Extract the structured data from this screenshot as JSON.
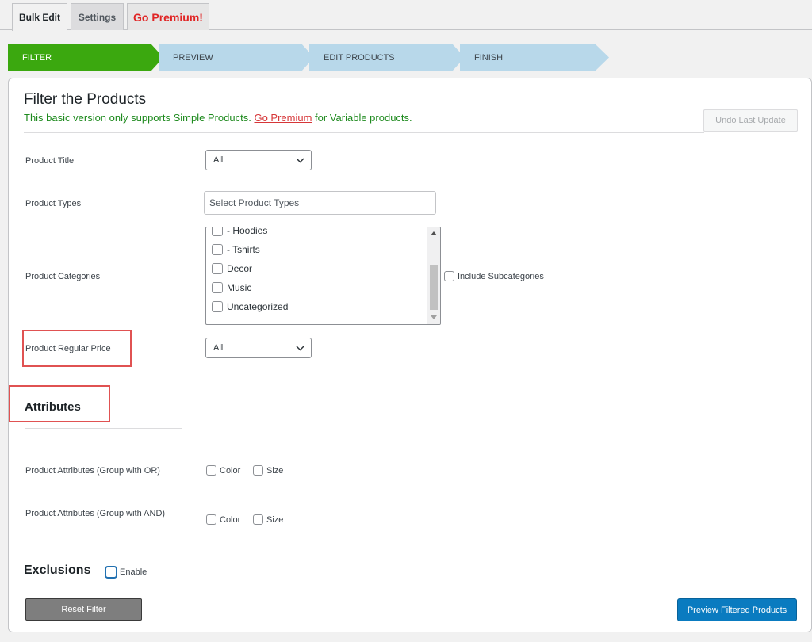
{
  "tabs": [
    {
      "label": "Bulk Edit"
    },
    {
      "label": "Settings"
    },
    {
      "label": "Go Premium!"
    }
  ],
  "steps": [
    {
      "label": "FILTER",
      "color": "#3ba80f",
      "text_color": "#ffffff"
    },
    {
      "label": "PREVIEW",
      "color": "#b8d8ea",
      "text_color": "#3c434a"
    },
    {
      "label": "EDIT PRODUCTS",
      "color": "#b8d8ea",
      "text_color": "#3c434a"
    },
    {
      "label": "FINISH",
      "color": "#b8d8ea",
      "text_color": "#3c434a"
    }
  ],
  "panel": {
    "title": "Filter the Products",
    "note_before": "This basic version only supports Simple Products. ",
    "note_link": "Go Premium",
    "note_after": " for Variable products.",
    "undo_label": "Undo Last Update"
  },
  "fields": {
    "product_title": {
      "label": "Product Title",
      "value": "All"
    },
    "product_types": {
      "label": "Product Types",
      "placeholder": "Select Product Types"
    },
    "product_categories": {
      "label": "Product Categories",
      "items": [
        "- Hoodies",
        "- Tshirts",
        "Decor",
        "Music",
        "Uncategorized"
      ],
      "include_sub_label": "Include Subcategories"
    },
    "product_regular_price": {
      "label": "Product Regular Price",
      "value": "All"
    }
  },
  "attributes": {
    "heading": "Attributes",
    "group_or": {
      "label": "Product Attributes (Group with OR)",
      "options": [
        "Color",
        "Size"
      ]
    },
    "group_and": {
      "label": "Product Attributes (Group with AND)",
      "options": [
        "Color",
        "Size"
      ]
    }
  },
  "exclusions": {
    "heading": "Exclusions",
    "enable_label": "Enable"
  },
  "buttons": {
    "reset": "Reset Filter",
    "preview": "Preview Filtered Products"
  }
}
